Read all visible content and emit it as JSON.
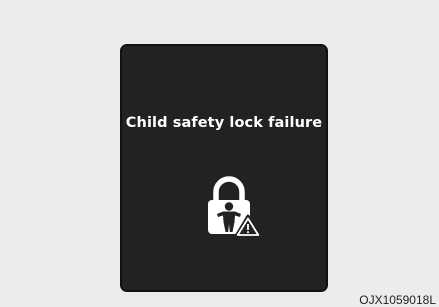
{
  "display": {
    "message": "Child safety lock failure",
    "icon": "child-lock-warning-icon",
    "background_color": "#222222",
    "text_color": "#ffffff"
  },
  "figure": {
    "reference_code": "OJX1059018L"
  }
}
